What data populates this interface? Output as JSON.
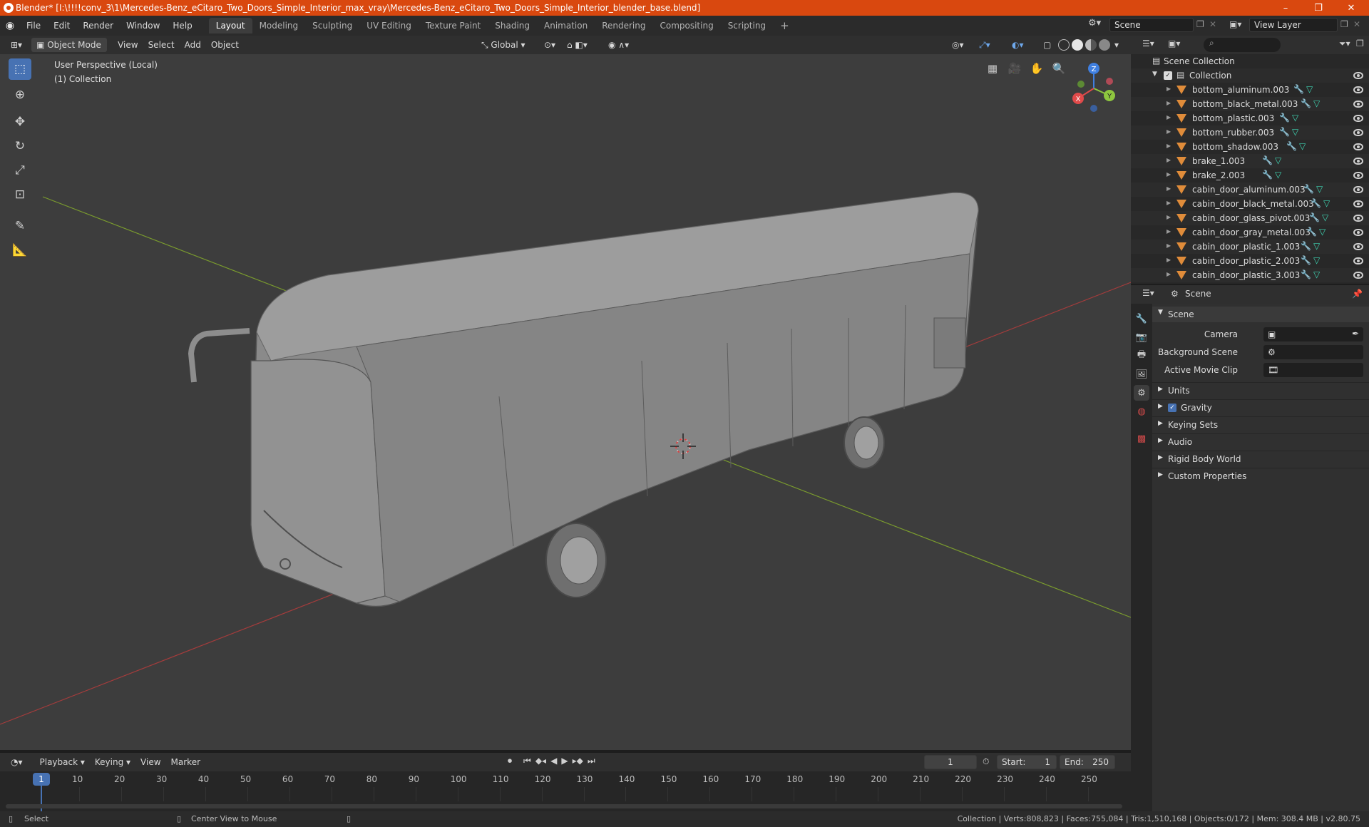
{
  "window": {
    "title": "Blender* [I:\\!!!!conv_3\\1\\Mercedes-Benz_eCitaro_Two_Doors_Simple_Interior_max_vray\\Mercedes-Benz_eCitaro_Two_Doors_Simple_Interior_blender_base.blend]",
    "minimize": "–",
    "maximize": "❐",
    "close": "✕"
  },
  "menubar": {
    "menus": [
      "File",
      "Edit",
      "Render",
      "Window",
      "Help"
    ],
    "workspaces": [
      "Layout",
      "Modeling",
      "Sculpting",
      "UV Editing",
      "Texture Paint",
      "Shading",
      "Animation",
      "Rendering",
      "Compositing",
      "Scripting"
    ],
    "active_workspace": "Layout",
    "add_workspace": "+",
    "scene_label": "Scene",
    "view_layer_label": "View Layer"
  },
  "viewport_header": {
    "mode": "Object Mode",
    "menus": [
      "View",
      "Select",
      "Add",
      "Object"
    ],
    "orientation": "Global"
  },
  "viewport": {
    "perspective_label": "User Perspective (Local)",
    "collection_label": "(1) Collection",
    "gizmo": {
      "x": "X",
      "y": "Y",
      "z": "Z"
    }
  },
  "outliner": {
    "search_placeholder": "",
    "root": "Scene Collection",
    "collection": "Collection",
    "objects": [
      "bottom_aluminum.003",
      "bottom_black_metal.003",
      "bottom_plastic.003",
      "bottom_rubber.003",
      "bottom_shadow.003",
      "brake_1.003",
      "brake_2.003",
      "cabin_door_aluminum.003",
      "cabin_door_black_metal.003",
      "cabin_door_glass_pivot.003",
      "cabin_door_gray_metal.003",
      "cabin_door_plastic_1.003",
      "cabin_door_plastic_2.003",
      "cabin_door_plastic_3.003"
    ]
  },
  "properties": {
    "header": "Scene",
    "panel_title": "Scene",
    "fields": [
      {
        "label": "Camera",
        "value": ""
      },
      {
        "label": "Background Scene",
        "value": ""
      },
      {
        "label": "Active Movie Clip",
        "value": ""
      }
    ],
    "subpanels": [
      "Units",
      "Gravity",
      "Keying Sets",
      "Audio",
      "Rigid Body World",
      "Custom Properties"
    ],
    "gravity_checked": true
  },
  "timeline": {
    "menus": [
      "Playback",
      "Keying",
      "View",
      "Marker"
    ],
    "current_frame": "1",
    "start_label": "Start:",
    "start": "1",
    "end_label": "End:",
    "end": "250",
    "ticks": [
      "1",
      "10",
      "20",
      "30",
      "40",
      "50",
      "60",
      "70",
      "80",
      "90",
      "100",
      "110",
      "120",
      "130",
      "140",
      "150",
      "160",
      "170",
      "180",
      "190",
      "200",
      "210",
      "220",
      "230",
      "240",
      "250"
    ]
  },
  "statusbar": {
    "select": "Select",
    "center_view": "Center View to Mouse",
    "stats": "Collection | Verts:808,823 | Faces:755,084 | Tris:1,510,168 | Objects:0/172 | Mem: 308.4 MB | v2.80.75"
  },
  "colors": {
    "titlebar": "#d9480f",
    "accent_blue": "#4772b3",
    "mesh_orange": "#e08c3a",
    "x_axis": "#e04a4a",
    "y_axis": "#8ec63f",
    "z_axis": "#3f7fe0"
  }
}
